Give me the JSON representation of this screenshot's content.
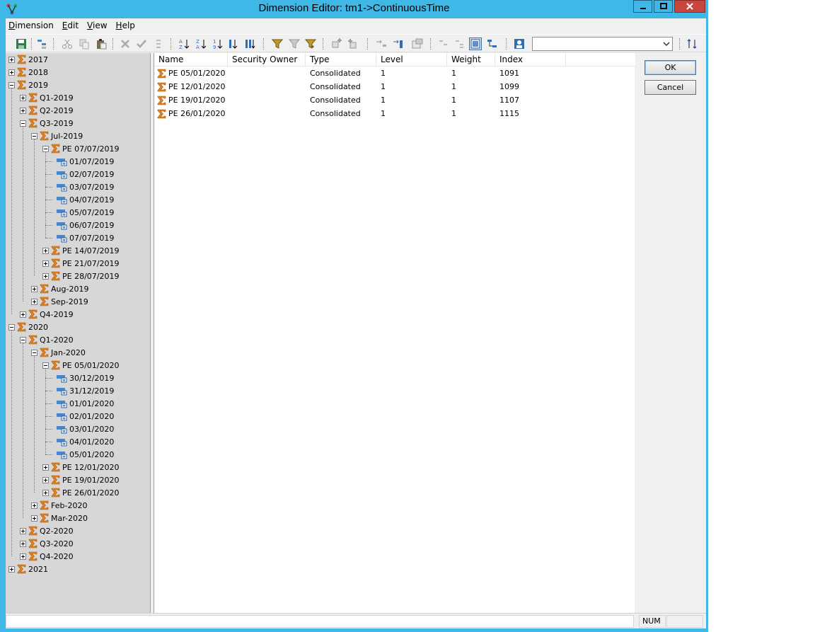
{
  "window": {
    "title": "Dimension Editor: tm1->ContinuousTime",
    "colors": {
      "titlebar": "#3fb8e8",
      "close": "#c7463e",
      "sigma": "#e8841c",
      "leaf": "#4a86c8"
    }
  },
  "menu": [
    {
      "label": "Dimension",
      "accel": "D"
    },
    {
      "label": "Edit",
      "accel": "E"
    },
    {
      "label": "View",
      "accel": "V"
    },
    {
      "label": "Help",
      "accel": "H"
    }
  ],
  "toolbar": {
    "icons": [
      "save-icon",
      "insert-element-icon",
      "cut-icon",
      "copy-icon",
      "paste-icon",
      "delete-icon",
      "accept-icon",
      "order-icon",
      "sort-az-icon",
      "sort-za-icon",
      "sort-index-asc-icon",
      "sort-index-desc-icon",
      "sort-hierarchy-icon",
      "filter-icon",
      "filter-clear-icon",
      "filter-wildcard-icon",
      "add-sibling-icon",
      "add-child-icon",
      "indent-icon",
      "outdent-icon",
      "properties-icon",
      "collapse-icon",
      "expand-icon",
      "display-properties-icon",
      "hierarchy-icon",
      "security-icon",
      "subset-refresh-icon"
    ],
    "subset_combo_value": ""
  },
  "tree": {
    "nodes": [
      {
        "label": "2017",
        "type": "consolidated",
        "expander": "plus"
      },
      {
        "label": "2018",
        "type": "consolidated",
        "expander": "plus"
      },
      {
        "label": "2019",
        "type": "consolidated",
        "expander": "minus"
      },
      {
        "label": "Q1-2019",
        "type": "consolidated",
        "expander": "plus"
      },
      {
        "label": "Q2-2019",
        "type": "consolidated",
        "expander": "plus"
      },
      {
        "label": "Q3-2019",
        "type": "consolidated",
        "expander": "minus"
      },
      {
        "label": "Jul-2019",
        "type": "consolidated",
        "expander": "minus"
      },
      {
        "label": "PE 07/07/2019",
        "type": "consolidated",
        "expander": "minus"
      },
      {
        "label": "01/07/2019",
        "type": "leaf"
      },
      {
        "label": "02/07/2019",
        "type": "leaf"
      },
      {
        "label": "03/07/2019",
        "type": "leaf"
      },
      {
        "label": "04/07/2019",
        "type": "leaf"
      },
      {
        "label": "05/07/2019",
        "type": "leaf"
      },
      {
        "label": "06/07/2019",
        "type": "leaf"
      },
      {
        "label": "07/07/2019",
        "type": "leaf"
      },
      {
        "label": "PE 14/07/2019",
        "type": "consolidated",
        "expander": "plus"
      },
      {
        "label": "PE 21/07/2019",
        "type": "consolidated",
        "expander": "plus"
      },
      {
        "label": "PE 28/07/2019",
        "type": "consolidated",
        "expander": "plus"
      },
      {
        "label": "Aug-2019",
        "type": "consolidated",
        "expander": "plus"
      },
      {
        "label": "Sep-2019",
        "type": "consolidated",
        "expander": "plus"
      },
      {
        "label": "Q4-2019",
        "type": "consolidated",
        "expander": "plus"
      },
      {
        "label": "2020",
        "type": "consolidated",
        "expander": "minus"
      },
      {
        "label": "Q1-2020",
        "type": "consolidated",
        "expander": "minus"
      },
      {
        "label": "Jan-2020",
        "type": "consolidated",
        "expander": "minus"
      },
      {
        "label": "PE 05/01/2020",
        "type": "consolidated",
        "expander": "minus"
      },
      {
        "label": "30/12/2019",
        "type": "leaf"
      },
      {
        "label": "31/12/2019",
        "type": "leaf"
      },
      {
        "label": "01/01/2020",
        "type": "leaf"
      },
      {
        "label": "02/01/2020",
        "type": "leaf"
      },
      {
        "label": "03/01/2020",
        "type": "leaf"
      },
      {
        "label": "04/01/2020",
        "type": "leaf"
      },
      {
        "label": "05/01/2020",
        "type": "leaf"
      },
      {
        "label": "PE 12/01/2020",
        "type": "consolidated",
        "expander": "plus"
      },
      {
        "label": "PE 19/01/2020",
        "type": "consolidated",
        "expander": "plus"
      },
      {
        "label": "PE 26/01/2020",
        "type": "consolidated",
        "expander": "plus"
      },
      {
        "label": "Feb-2020",
        "type": "consolidated",
        "expander": "plus"
      },
      {
        "label": "Mar-2020",
        "type": "consolidated",
        "expander": "plus"
      },
      {
        "label": "Q2-2020",
        "type": "consolidated",
        "expander": "plus"
      },
      {
        "label": "Q3-2020",
        "type": "consolidated",
        "expander": "plus"
      },
      {
        "label": "Q4-2020",
        "type": "consolidated",
        "expander": "plus"
      },
      {
        "label": "2021",
        "type": "consolidated",
        "expander": "plus"
      }
    ]
  },
  "list": {
    "columns": [
      "Name",
      "Security Owner",
      "Type",
      "Level",
      "Weight",
      "Index"
    ],
    "rows": [
      {
        "name": "PE 05/01/2020",
        "security_owner": "",
        "type": "Consolidated",
        "level": "1",
        "weight": "1",
        "index": "1091"
      },
      {
        "name": "PE 12/01/2020",
        "security_owner": "",
        "type": "Consolidated",
        "level": "1",
        "weight": "1",
        "index": "1099"
      },
      {
        "name": "PE 19/01/2020",
        "security_owner": "",
        "type": "Consolidated",
        "level": "1",
        "weight": "1",
        "index": "1107"
      },
      {
        "name": "PE 26/01/2020",
        "security_owner": "",
        "type": "Consolidated",
        "level": "1",
        "weight": "1",
        "index": "1115"
      }
    ]
  },
  "buttons": {
    "ok": "OK",
    "cancel": "Cancel"
  },
  "status": {
    "message": "",
    "num": "NUM"
  }
}
